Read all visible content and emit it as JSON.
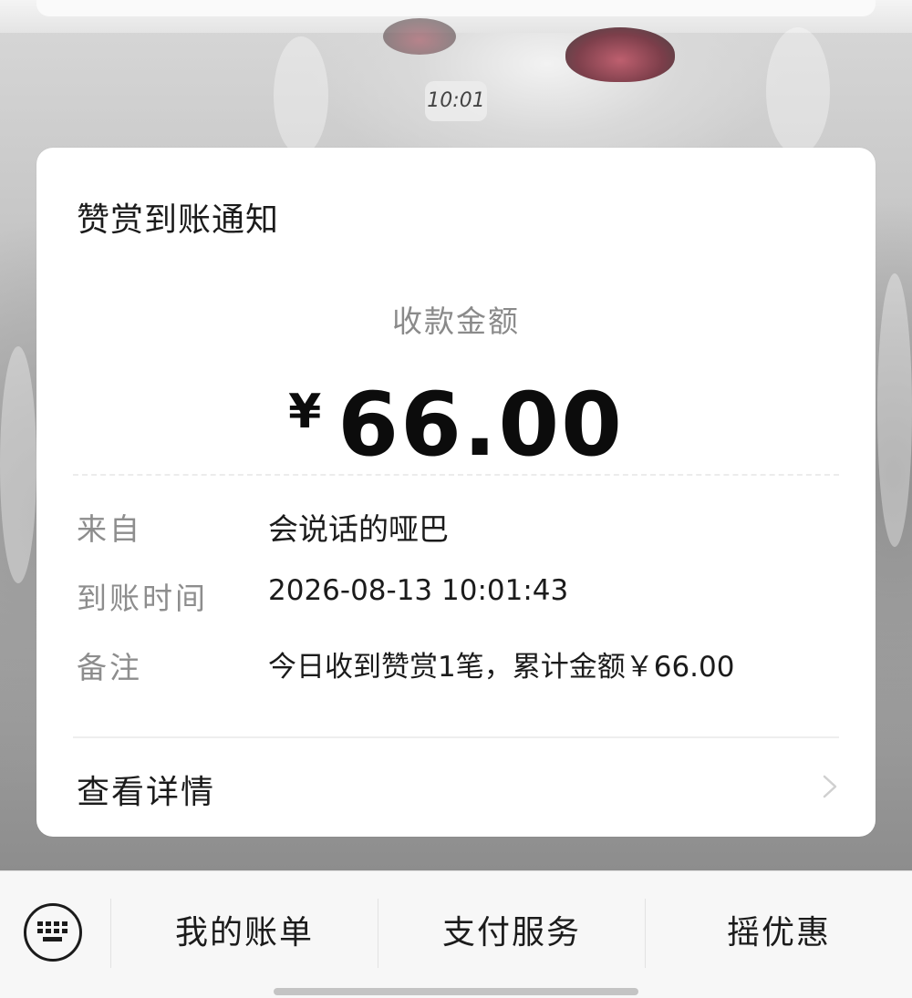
{
  "background": {
    "chat_time": "10:01"
  },
  "notification": {
    "title": "赞赏到账通知",
    "amount_label": "收款金额",
    "currency_symbol": "¥",
    "amount": "66.00",
    "rows": [
      {
        "key": "来自",
        "value": "会说话的哑巴"
      },
      {
        "key": "到账时间",
        "value": "2026-08-13 10:01:43"
      },
      {
        "key": "备注",
        "value": "今日收到赞赏1笔，累计金额￥66.00"
      }
    ],
    "details_label": "查看详情"
  },
  "bottom_menu": {
    "keyboard_icon": "keyboard-icon",
    "items": [
      {
        "label": "我的账单"
      },
      {
        "label": "支付服务"
      },
      {
        "label": "摇优惠"
      }
    ]
  },
  "colors": {
    "card_bg": "#ffffff",
    "muted_text": "#8d8d8d",
    "primary_text": "#1b1b1b",
    "bar_bg": "#f7f7f7"
  }
}
